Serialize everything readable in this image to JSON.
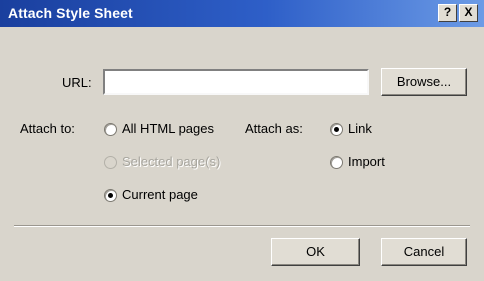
{
  "window": {
    "title": "Attach Style Sheet",
    "help_label": "?",
    "close_label": "X"
  },
  "url": {
    "label": "URL:",
    "value": "",
    "placeholder": "",
    "browse_label": "Browse..."
  },
  "attach_to": {
    "label": "Attach to:",
    "options": [
      {
        "label": "All HTML pages",
        "selected": false,
        "enabled": true
      },
      {
        "label": "Selected page(s)",
        "selected": false,
        "enabled": false
      },
      {
        "label": "Current page",
        "selected": true,
        "enabled": true
      }
    ]
  },
  "attach_as": {
    "label": "Attach as:",
    "options": [
      {
        "label": "Link",
        "selected": true,
        "enabled": true
      },
      {
        "label": "Import",
        "selected": false,
        "enabled": true
      }
    ]
  },
  "buttons": {
    "ok_label": "OK",
    "cancel_label": "Cancel"
  }
}
